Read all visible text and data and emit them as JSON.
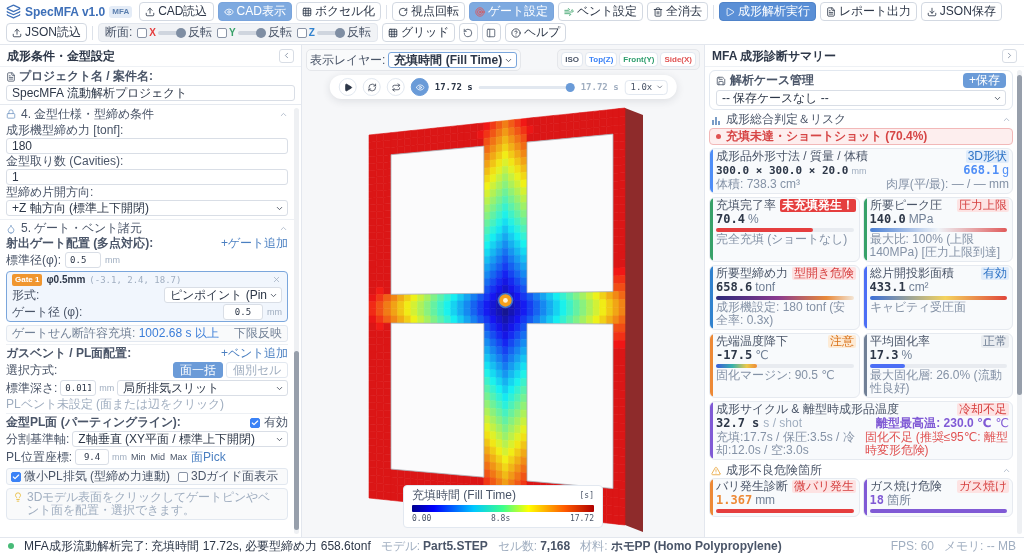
{
  "app": {
    "title": "SpecMFA v1.0",
    "badge": "MFA"
  },
  "toolbar": {
    "groups": [
      [
        {
          "label": "CAD読込",
          "on": false,
          "primary": false
        },
        {
          "label": "CAD表示",
          "on": true,
          "primary": false
        },
        {
          "label": "ボクセル化",
          "on": false,
          "primary": false
        }
      ],
      [
        {
          "label": "視点回転",
          "on": false,
          "primary": false
        },
        {
          "label": "ゲート設定",
          "on": true,
          "primary": false
        },
        {
          "label": "ベント設定",
          "on": false,
          "primary": false
        },
        {
          "label": "全消去",
          "on": false,
          "primary": false
        }
      ],
      [
        {
          "label": "成形解析実行",
          "on": false,
          "primary": true
        },
        {
          "label": "レポート出力",
          "on": false,
          "primary": false
        },
        {
          "label": "JSON保存",
          "on": false,
          "primary": false
        },
        {
          "label": "JSON読込",
          "on": false,
          "primary": false
        }
      ]
    ],
    "slice": {
      "label": "断面:",
      "axes": [
        {
          "axis": "X",
          "color": "#e53e3e",
          "checked": false,
          "level": 1,
          "flip": "反転"
        },
        {
          "axis": "Y",
          "color": "#38a169",
          "checked": false,
          "level": 1,
          "flip": "反転"
        },
        {
          "axis": "Z",
          "color": "#3182ce",
          "checked": false,
          "level": 1,
          "flip": "反転"
        }
      ]
    },
    "grid": {
      "label": "グリッド",
      "on": false
    },
    "help": {
      "label": "ヘルプ"
    }
  },
  "left_panel": {
    "title": "成形条件・金型設定",
    "project": {
      "label": "プロジェクト名 / 案件名:",
      "value": "SpecMFA 流動解析プロジェクト"
    },
    "mold": {
      "title": "4. 金型仕様・型締め条件",
      "expanded": true,
      "fields": [
        {
          "kind": "input",
          "label": "成形機型締め力 [tonf]:",
          "value": "180"
        },
        {
          "kind": "input",
          "label": "金型取り数 (Cavities):",
          "value": "1"
        },
        {
          "kind": "select",
          "label": "型締め片開方向:",
          "value": "+Z 軸方向 (標準上下開閉)"
        }
      ]
    },
    "gate_vent": {
      "title": "5. ゲート・ベント諸元",
      "expanded": true,
      "gates": {
        "label": "射出ゲート配置 (多点対応):",
        "add": "+ゲート追加",
        "size_label": "標準径(φ):",
        "size_value": "0.5",
        "unit": "mm",
        "items": [
          {
            "badge": "Gate 1",
            "size": "φ0.5mm",
            "position": "(-3.1, 2.4, 18.7)",
            "selected": true,
            "type_label": "形式:",
            "type_value": "ピンポイント (Pin",
            "diameter_label": "ゲート径 (φ):",
            "diameter_value": "0.5",
            "unit": "mm"
          }
        ],
        "shear_label": "ゲートせん断許容充填:",
        "shear_value": "1002.68 s 以上",
        "shear_action": "下限反映"
      },
      "vents": {
        "label": "ガスベント / PL面配置:",
        "add": "+ベント追加",
        "mode_label": "選択方式:",
        "modes": [
          {
            "label": "面一括",
            "selected": true
          },
          {
            "label": "個別セル",
            "selected": false
          }
        ],
        "depth_label": "標準深さ:",
        "depth_value": "0.011",
        "unit": "mm",
        "type_value": "局所排気スリット",
        "empty_note": "PLベント未設定 (面または辺をクリック)"
      },
      "parting": {
        "label": "金型PL面 (パーティングライン):",
        "enabled_label": "有効",
        "enabled": true,
        "axis_label": "分割基準軸:",
        "axis_value": "Z軸垂直 (XY平面 / 標準上下開閉)",
        "position_label": "PL位置座標:",
        "position_value": "9.4",
        "unit": "mm",
        "presets": [
          "Min",
          "Mid",
          "Max"
        ],
        "pick": "面Pick",
        "options": [
          {
            "label": "微小PL排気 (型締め力連動)",
            "checked": true
          },
          {
            "label": "3Dガイド面表示",
            "checked": false
          }
        ]
      },
      "hint": "3Dモデル表面をクリックしてゲートピンやベント面を配置・選択できます。"
    }
  },
  "viewport": {
    "layer": {
      "label": "表示レイヤー:",
      "value": "充填時間 (Fill Time)"
    },
    "views": [
      {
        "label": "ISO",
        "color": "#4a5568"
      },
      {
        "label": "Top(Z)",
        "color": "#3b82f6"
      },
      {
        "label": "Front(Y)",
        "color": "#2f9e6e"
      },
      {
        "label": "Side(X)",
        "color": "#e05252"
      }
    ],
    "playback": {
      "buttons": [
        {
          "on": false
        },
        {
          "on": false
        },
        {
          "on": false
        },
        {
          "on": true
        }
      ],
      "time": "17.72 s",
      "level": 1,
      "total": "17.72 s",
      "speed": "1.0x"
    },
    "legend": {
      "title": "充填時間 (Fill Time)",
      "unit": "[s]",
      "ticks": [
        "0.00",
        "8.8s",
        "17.72"
      ]
    }
  },
  "right_panel": {
    "title": "MFA 成形診断サマリー",
    "cases": {
      "title": "解析ケース管理",
      "save": "+保存",
      "value": "-- 保存ケースなし --"
    },
    "overview": {
      "title": "成形総合判定＆リスク",
      "expanded": true,
      "alert": "充填未達・ショートショット (70.4%)",
      "size": {
        "title": "成形品外形寸法 / 質量 / 体積",
        "color": "#4f8ef7",
        "badge": {
          "label": "3D形状",
          "kind": "info"
        },
        "dimensions": "300.0 × 300.0 × 20.0",
        "unit": "mm",
        "mass": "668.1",
        "mass_unit": "g",
        "volume": "体積: 738.3 cm³",
        "thickness": "肉厚(平/最): — / — mm"
      },
      "metrics": [
        {
          "title": "充填完了率",
          "color": "#38a169",
          "badge": {
            "label": "未充填発生！",
            "kind": "alert"
          },
          "value": "70.4",
          "unit": "%",
          "highlight": false,
          "bar": {
            "kind": "solid",
            "color": "#e53e3e",
            "level": 0.704
          },
          "note": "完全充填 (ショートなし)"
        },
        {
          "title": "所要ピーク圧",
          "color": "#38a169",
          "badge": {
            "label": "圧力上限",
            "kind": "danger"
          },
          "value": "140.0",
          "unit": "MPa",
          "highlight": false,
          "bar": {
            "kind": "diverging"
          },
          "note": "最大比: 100% (上限 140MPa) [圧力上限到達]"
        },
        {
          "title": "所要型締め力",
          "color": "#3182ce",
          "badge": {
            "label": "型開き危険",
            "kind": "danger"
          },
          "value": "658.6",
          "unit": "tonf",
          "highlight": false,
          "bar": {
            "kind": "plasma"
          },
          "note": "成形機設定: 180 tonf (安全率: 0.3x)"
        },
        {
          "title": "総片開投影面積",
          "color": "#4c6ef5",
          "badge": {
            "label": "有効",
            "kind": "info"
          },
          "value": "433.1",
          "unit": "cm²",
          "highlight": false,
          "bar": {
            "kind": "spectrum"
          },
          "note": "キャビティ受圧面"
        },
        {
          "title": "先端温度降下",
          "color": "#ed8936",
          "badge": {
            "label": "注意",
            "kind": "warn"
          },
          "value": "-17.5",
          "unit": "℃",
          "highlight": false,
          "bar": {
            "kind": "jet",
            "level": 0.3
          },
          "note": "固化マージン: 90.5 ℃"
        },
        {
          "title": "平均固化率",
          "color": "#718096",
          "badge": {
            "label": "正常",
            "kind": "neutral"
          },
          "value": "17.3",
          "unit": "%",
          "highlight": false,
          "bar": {
            "kind": "solid",
            "color": "#4c6ef5",
            "level": 0.26
          },
          "note": "最大固化層: 26.0% (流動性良好)"
        }
      ],
      "cycle": {
        "title": "成形サイクル & 離型時成形品温度",
        "color": "#805ad5",
        "badge": {
          "label": "冷却不足",
          "kind": "danger"
        },
        "value": "32.7 s",
        "unit": "s / shot",
        "temperature": "離型最高温: 230.0 ℃",
        "temperature_unit": "℃",
        "breakdown": "充填:17.7s / 保圧:3.5s / 冷却:12.0s / 空:3.0s",
        "warning": "固化不足 (推奨≤95℃: 離型時変形危険)"
      }
    },
    "defects": {
      "title": "成形不良危険箇所",
      "expanded": true,
      "metrics": [
        {
          "title": "バリ発生診断",
          "color": "#ed8936",
          "badge": {
            "label": "微バリ発生",
            "kind": "danger"
          },
          "value": "1.367",
          "unit": "mm",
          "highlight": true,
          "bar": {
            "kind": "solid",
            "color": "#e53e3e"
          }
        },
        {
          "title": "ガス焼け危険",
          "color": "#805ad5",
          "badge": {
            "label": "ガス焼け",
            "kind": "danger"
          },
          "value": "18",
          "unit": "箇所",
          "highlight": true,
          "bar": {
            "kind": "solid",
            "color": "#805ad5"
          }
        }
      ]
    }
  },
  "status_bar": {
    "complete": true,
    "message": "MFA成形流動解析完了: 充填時間 17.72s, 必要型締め力 658.6tonf",
    "items": [
      {
        "label": "モデル:",
        "value": "Part5.STEP"
      },
      {
        "label": "セル数:",
        "value": "7,168"
      },
      {
        "label": "材料:",
        "value": "ホモPP (Homo Polypropylene)"
      }
    ],
    "fps": "FPS: 60",
    "memory": "メモリ: -- MB"
  }
}
